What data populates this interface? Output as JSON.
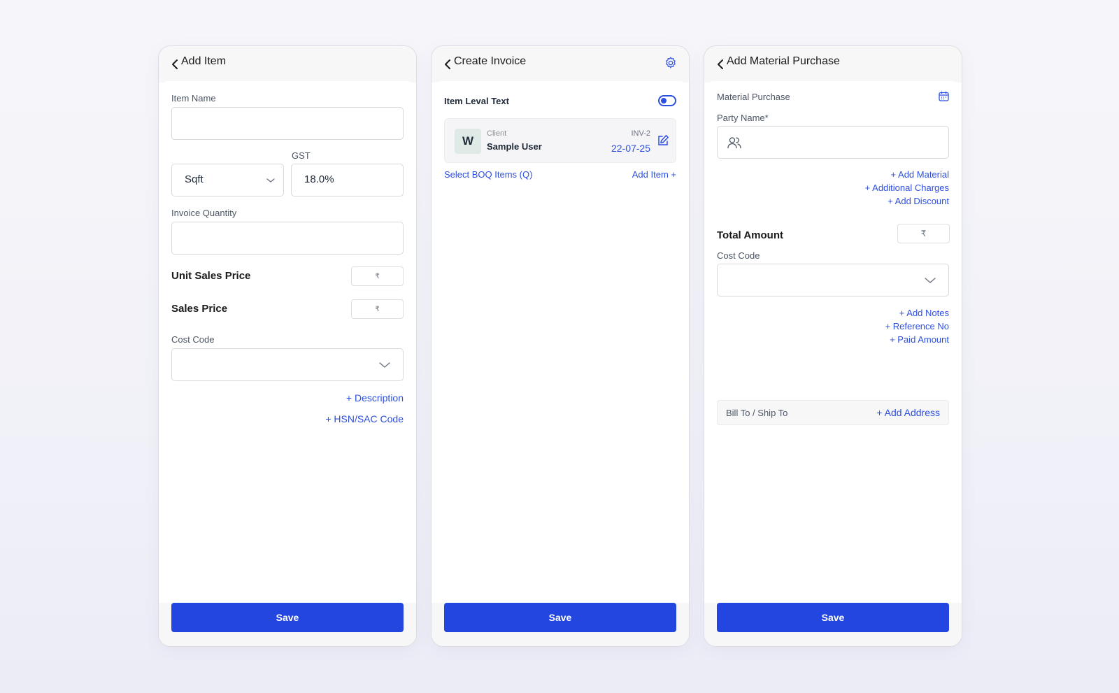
{
  "add_item": {
    "title": "Add Item",
    "item_name_label": "Item Name",
    "unit_value": "Sqft",
    "gst_label": "GST",
    "gst_value": "18.0%",
    "invoice_quantity_label": "Invoice Quantity",
    "unit_sales_price_label": "Unit Sales Price",
    "unit_sales_price_currency": "₹",
    "sales_price_label": "Sales Price",
    "sales_price_currency": "₹",
    "cost_code_label": "Cost Code",
    "description_link": "+ Description",
    "hsn_link": "+ HSN/SAC Code",
    "save_label": "Save"
  },
  "create_invoice": {
    "title": "Create Invoice",
    "item_level_text_label": "Item Leval Text",
    "toggle_on": true,
    "client": {
      "avatar_letter": "W",
      "caption": "Client",
      "name": "Sample User",
      "invoice_no": "INV-2",
      "date": "22-07-25"
    },
    "select_boq_link": "Select BOQ Items (Q)",
    "add_item_link": "Add Item  +",
    "save_label": "Save"
  },
  "add_material_purchase": {
    "title": "Add Material Purchase",
    "section_label": "Material Purchase",
    "party_name_label": "Party Name*",
    "add_material_link": "+ Add Material",
    "additional_charges_link": "+ Additional Charges",
    "add_discount_link": "+ Add Discount",
    "total_amount_label": "Total Amount",
    "total_amount_currency": "₹",
    "cost_code_label": "Cost Code",
    "add_notes_link": "+ Add Notes",
    "reference_no_link": "+ Reference No",
    "paid_amount_link": "+ Paid Amount",
    "bill_ship_label": "Bill To / Ship To",
    "add_address_link": "+ Add Address",
    "save_label": "Save"
  },
  "colors": {
    "accent": "#2346e0",
    "link": "#2d4fe0"
  },
  "icons": [
    "chevron-left-icon",
    "gear-icon",
    "chevron-down-icon",
    "edit-icon",
    "users-icon",
    "calendar-icon",
    "toggle-icon"
  ]
}
